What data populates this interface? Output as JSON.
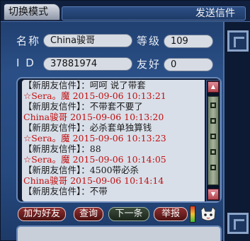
{
  "window": {
    "title": "发送信件"
  },
  "mode_button": {
    "label": "切换模式"
  },
  "info": {
    "name_label": "名称",
    "name_value": "China骏哥",
    "level_label": "等级",
    "level_value": "109",
    "id_label": "I D",
    "id_value": "37881974",
    "friendship_label": "友好",
    "friendship_value": "0"
  },
  "messages": [
    {
      "kind": "hdr",
      "text": "【新朋友信件】：呵呵 说了带套"
    },
    {
      "kind": "ts",
      "text": "☆Sera。魔 2015-09-06 10:13:21"
    },
    {
      "kind": "hdr",
      "text": "【新朋友信件】：不带套不要了"
    },
    {
      "kind": "ts",
      "text": "China骏哥 2015-09-06 10:13:20"
    },
    {
      "kind": "hdr",
      "text": "【新朋友信件】：必杀套单独算钱"
    },
    {
      "kind": "ts",
      "text": "☆Sera。魔 2015-09-06 10:13:23"
    },
    {
      "kind": "hdr",
      "text": "【新朋友信件】：88"
    },
    {
      "kind": "ts",
      "text": "☆Sera。魔 2015-09-06 10:14:05"
    },
    {
      "kind": "hdr",
      "text": "【新朋友信件】：4500带必杀"
    },
    {
      "kind": "ts",
      "text": "China骏哥 2015-09-06 10:14:14"
    },
    {
      "kind": "hdr",
      "text": "【新朋友信件】：不带"
    }
  ],
  "buttons": {
    "add_friend": "加为好友",
    "lookup": "查询",
    "next": "下一条",
    "report": "举报"
  },
  "icons": {
    "scroll_up": "triangle-up-icon",
    "scroll_down": "triangle-down-icon",
    "signal": "signal-light-icon",
    "avatar": "cat-avatar-icon"
  },
  "colors": {
    "timestamp_red": "#c01010",
    "message_bg": "#d8dfe9",
    "frame_blue": "#2a4f86"
  }
}
